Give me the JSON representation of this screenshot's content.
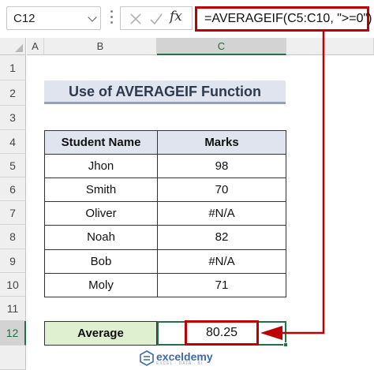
{
  "formula_bar": {
    "name_box": "C12",
    "formula": "=AVERAGEIF(C5:C10, \">=0\")",
    "fx_symbol": "fx"
  },
  "columns": [
    "A",
    "B",
    "C"
  ],
  "rows": [
    "1",
    "2",
    "3",
    "4",
    "5",
    "6",
    "7",
    "8",
    "9",
    "10",
    "11",
    "12"
  ],
  "title": "Use of AVERAGEIF Function",
  "table": {
    "headers": [
      "Student Name",
      "Marks"
    ],
    "rows": [
      {
        "name": "Jhon",
        "marks": "98"
      },
      {
        "name": "Smith",
        "marks": "70"
      },
      {
        "name": "Oliver",
        "marks": "#N/A"
      },
      {
        "name": "Noah",
        "marks": "82"
      },
      {
        "name": "Bob",
        "marks": "#N/A"
      },
      {
        "name": "Moly",
        "marks": "71"
      }
    ]
  },
  "average": {
    "label": "Average",
    "value": "80.25"
  },
  "watermark": {
    "brand": "exceldemy",
    "tagline": "EXCEL · DATA · BI"
  },
  "colors": {
    "highlight_red": "#c00000",
    "excel_green": "#217346",
    "header_fill": "#dfe4ee",
    "average_fill": "#dff0d0"
  }
}
